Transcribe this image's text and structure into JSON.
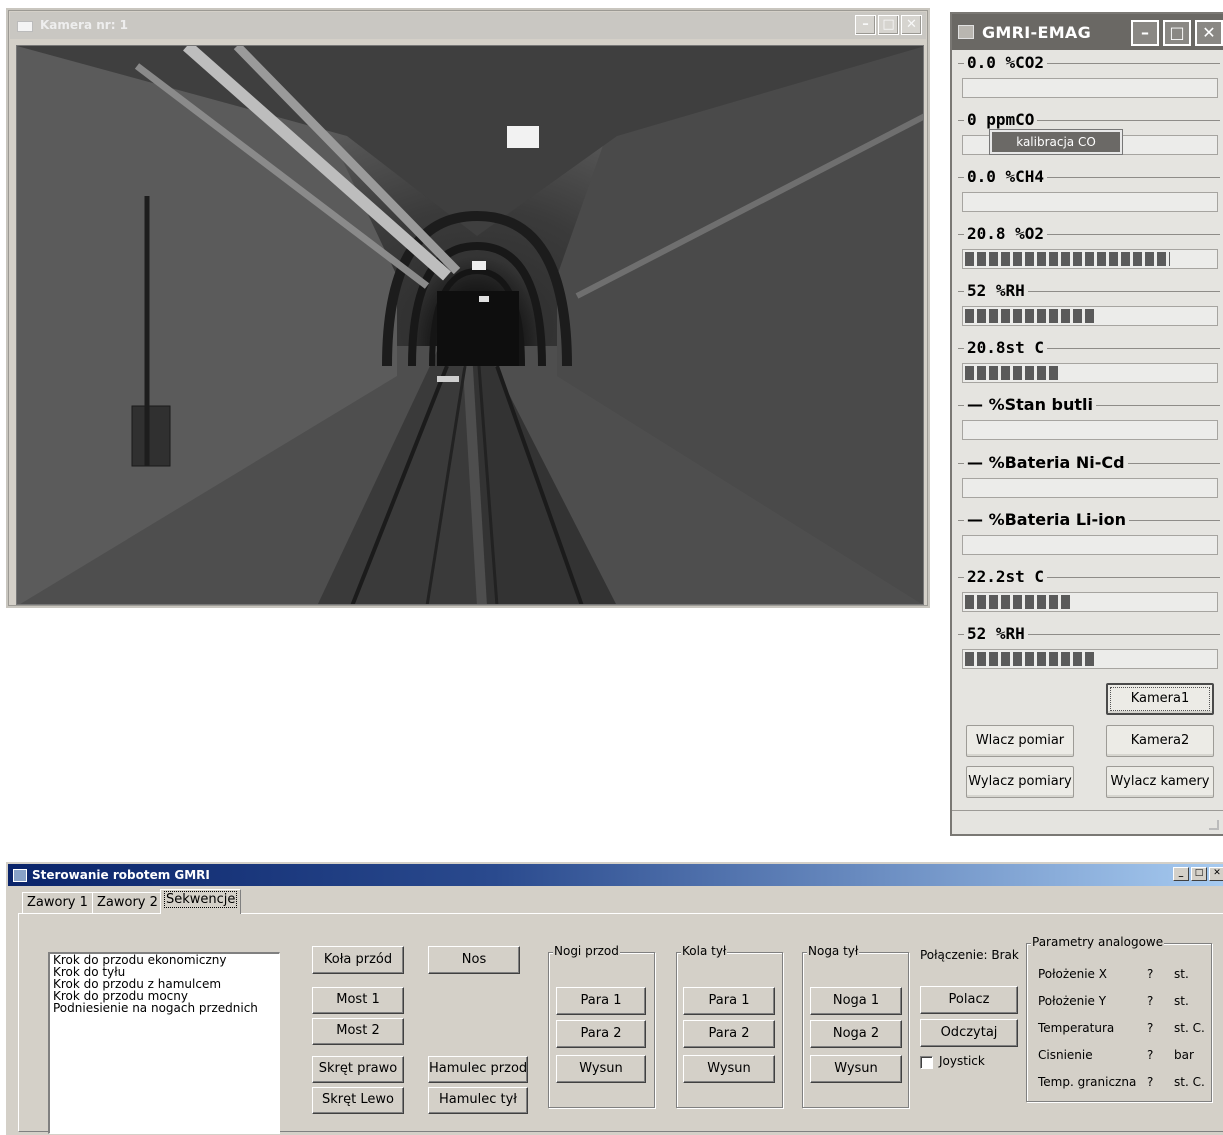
{
  "camera_window": {
    "title": "Kamera nr: 1",
    "buttons": [
      "–",
      "□",
      "✕"
    ]
  },
  "sensor_window": {
    "title": "GMRI-EMAG",
    "buttons": [
      "–",
      "□",
      "✕"
    ],
    "readings": [
      {
        "label": "0.0 %CO2",
        "level": 0
      },
      {
        "label": "0 ppmCO",
        "level": 0
      },
      {
        "label": "0.0 %CH4",
        "level": 0
      },
      {
        "label": "20.8 %O2",
        "level": 0.82
      },
      {
        "label": "52 %RH",
        "level": 0.52
      },
      {
        "label": "20.8st C",
        "level": 0.38
      },
      {
        "label": "— %Stan butli",
        "level": 0
      },
      {
        "label": "— %Bateria Ni-Cd",
        "level": 0
      },
      {
        "label": "— %Bateria Li-ion",
        "level": 0
      },
      {
        "label": "22.2st C",
        "level": 0.42
      },
      {
        "label": "52 %RH",
        "level": 0.52
      }
    ],
    "tooltip": "kalibracja CO",
    "buttons_panel": {
      "kamera1": "Kamera1",
      "wlacz_pomiar": "Wlacz pomiar",
      "kamera2": "Kamera2",
      "wylacz_pomiary": "Wylacz pomiary",
      "wylacz_kamery": "Wylacz kamery"
    }
  },
  "control_window": {
    "title": "Sterowanie robotem GMRI",
    "window_buttons": [
      "_",
      "□",
      "✕"
    ],
    "tabs": [
      "Zawory 1",
      "Zawory 2",
      "Sekwencje"
    ],
    "active_tab": "Sekwencje",
    "sequences": [
      "Krok do przodu ekonomiczny",
      "Krok do tyłu",
      "Krok do przodu z hamulcem",
      "Krok do przodu mocny",
      "Podniesienie na nogach przednich"
    ],
    "buttons": {
      "kola_przod": "Koła przód",
      "nos": "Nos",
      "most1": "Most 1",
      "most2": "Most 2",
      "skret_prawo": "Skręt prawo",
      "skret_lewo": "Skręt Lewo",
      "hamulec_przod": "Hamulec przod",
      "hamulec_tyl": "Hamulec tył"
    },
    "nogi_przod": {
      "title": "Nogi przod",
      "b1": "Para 1",
      "b2": "Para 2",
      "b3": "Wysun"
    },
    "kola_tyl": {
      "title": "Kola tył",
      "b1": "Para 1",
      "b2": "Para 2",
      "b3": "Wysun"
    },
    "noga_tyl": {
      "title": "Noga tył",
      "b1": "Noga 1",
      "b2": "Noga 2",
      "b3": "Wysun"
    },
    "connection": {
      "status": "Połączenie: Brak",
      "polacz": "Polacz",
      "odczytaj": "Odczytaj",
      "joystick": "Joystick"
    },
    "analog": {
      "title": "Parametry analogowe",
      "rows": [
        {
          "name": "Położenie X",
          "value": "?",
          "unit": "st."
        },
        {
          "name": "Położenie Y",
          "value": "?",
          "unit": "st."
        },
        {
          "name": "Temperatura",
          "value": "?",
          "unit": "st. C."
        },
        {
          "name": "Cisnienie",
          "value": "?",
          "unit": "bar"
        },
        {
          "name": "Temp. graniczna",
          "value": "?",
          "unit": "st. C."
        }
      ]
    }
  }
}
